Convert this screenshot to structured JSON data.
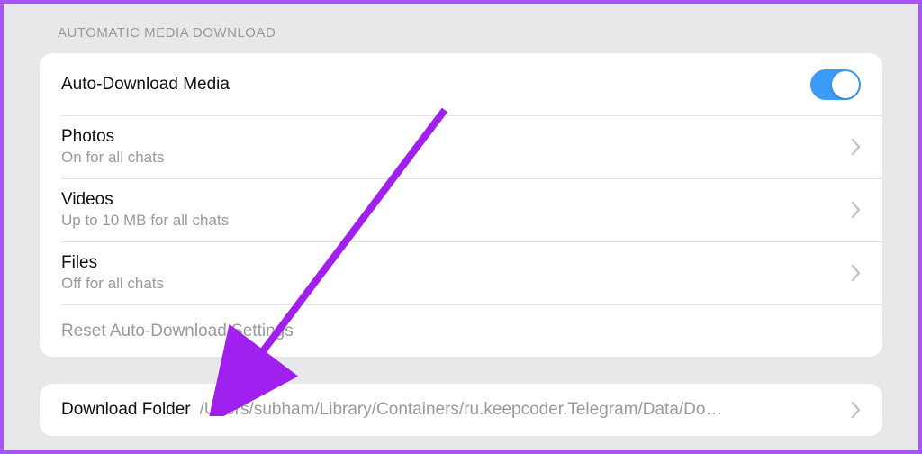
{
  "section_header": "AUTOMATIC MEDIA DOWNLOAD",
  "auto_download": {
    "label": "Auto-Download Media",
    "enabled": true
  },
  "photos": {
    "label": "Photos",
    "subtitle": "On for all chats"
  },
  "videos": {
    "label": "Videos",
    "subtitle": "Up to 10 MB for all chats"
  },
  "files": {
    "label": "Files",
    "subtitle": "Off for all chats"
  },
  "reset": {
    "label": "Reset Auto-Download Settings"
  },
  "download_folder": {
    "label": "Download Folder",
    "path": "/Users/subham/Library/Containers/ru.keepcoder.Telegram/Data/Do…"
  }
}
